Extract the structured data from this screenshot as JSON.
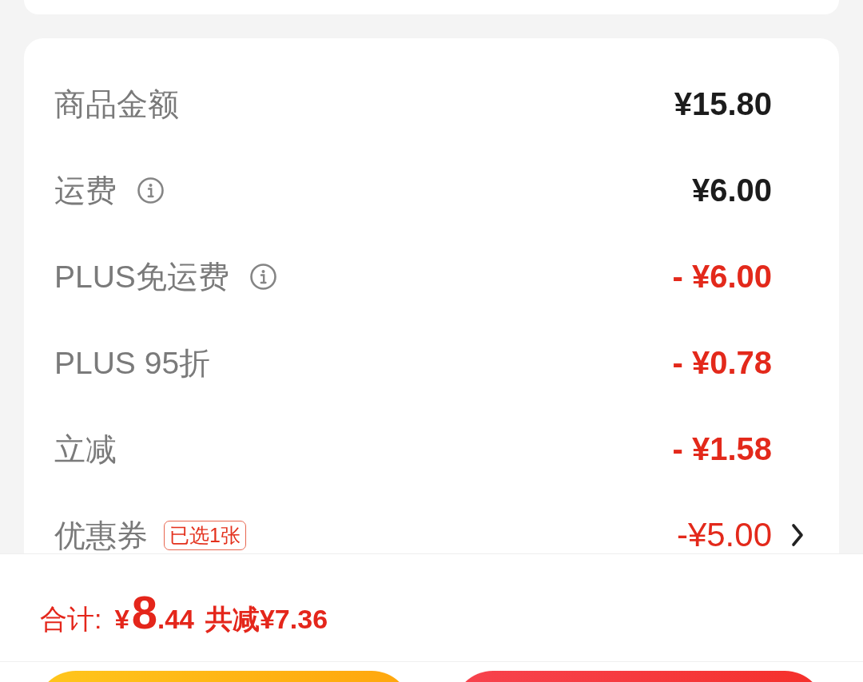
{
  "summary": {
    "rows": [
      {
        "kind": "charge",
        "label": "商品金额",
        "info": false,
        "value": "¥15.80"
      },
      {
        "kind": "charge",
        "label": "运费",
        "info": true,
        "value": "¥6.00"
      },
      {
        "kind": "discount",
        "label": "PLUS免运费",
        "info": true,
        "value": "- ¥6.00"
      },
      {
        "kind": "discount",
        "label": "PLUS 95折",
        "info": false,
        "value": "- ¥0.78"
      },
      {
        "kind": "discount",
        "label": "立减",
        "info": false,
        "value": "- ¥1.58"
      },
      {
        "kind": "coupon",
        "label": "优惠券",
        "info": false,
        "badge": "已选1张",
        "value": "-¥5.00"
      }
    ]
  },
  "checkout": {
    "total_label": "合计:",
    "total": {
      "symbol": "¥",
      "whole": "8",
      "fraction": ".44"
    },
    "savings": "共减¥7.36"
  },
  "buttons": [
    {
      "kind": "secondary"
    },
    {
      "kind": "primary"
    }
  ]
}
